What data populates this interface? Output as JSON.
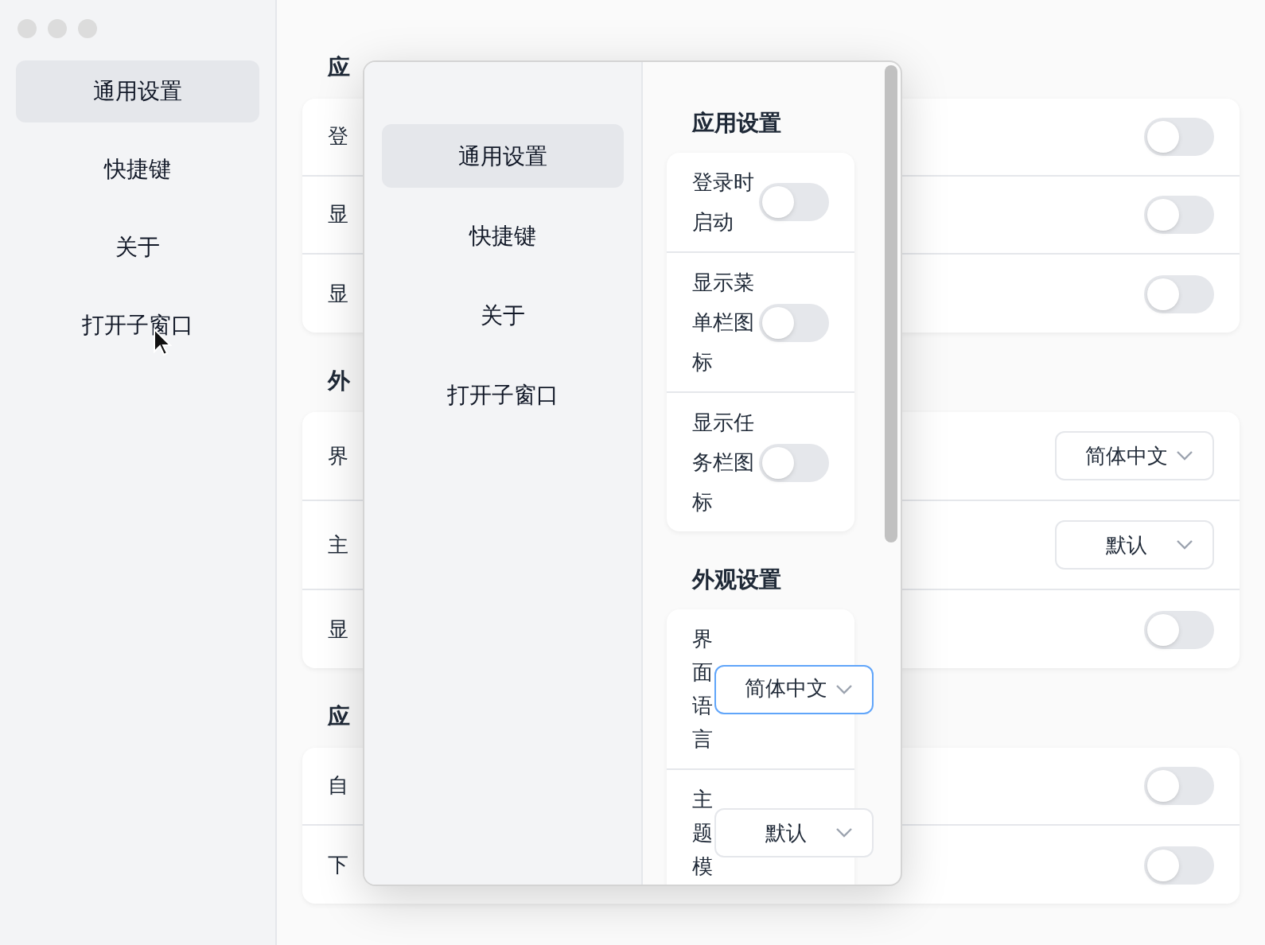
{
  "main_window": {
    "sidebar": {
      "items": [
        {
          "label": "通用设置",
          "selected": true
        },
        {
          "label": "快捷键",
          "selected": false
        },
        {
          "label": "关于",
          "selected": false
        },
        {
          "label": "打开子窗口",
          "selected": false
        }
      ]
    },
    "sections": [
      {
        "heading": "应",
        "rows": [
          {
            "label": "登",
            "kind": "toggle",
            "on": false
          },
          {
            "label": "显",
            "kind": "toggle",
            "on": false
          },
          {
            "label": "显",
            "kind": "toggle",
            "on": false
          }
        ]
      },
      {
        "heading": "外",
        "rows": [
          {
            "label": "界",
            "kind": "select",
            "value": "简体中文",
            "focused": false
          },
          {
            "label": "主",
            "kind": "select",
            "value": "默认",
            "focused": false
          },
          {
            "label": "显",
            "kind": "toggle",
            "on": false
          }
        ]
      },
      {
        "heading": "应",
        "rows": [
          {
            "label": "自",
            "kind": "toggle",
            "on": false
          },
          {
            "label": "下",
            "kind": "toggle",
            "on": false
          }
        ]
      }
    ]
  },
  "child_window": {
    "sidebar": {
      "items": [
        {
          "label": "通用设置",
          "selected": true
        },
        {
          "label": "快捷键",
          "selected": false
        },
        {
          "label": "关于",
          "selected": false
        },
        {
          "label": "打开子窗口",
          "selected": false
        }
      ]
    },
    "sections": [
      {
        "heading": "应用设置",
        "rows": [
          {
            "label": "登录时启动",
            "kind": "toggle",
            "on": false
          },
          {
            "label": "显示菜单栏图标",
            "kind": "toggle",
            "on": false
          },
          {
            "label": "显示任务栏图标",
            "kind": "toggle",
            "on": false
          }
        ]
      },
      {
        "heading": "外观设置",
        "rows": [
          {
            "label": "界面语言",
            "kind": "select",
            "value": "简体中文",
            "focused": true
          },
          {
            "label": "主题模",
            "kind": "select",
            "value": "默认",
            "focused": false
          }
        ]
      }
    ]
  }
}
